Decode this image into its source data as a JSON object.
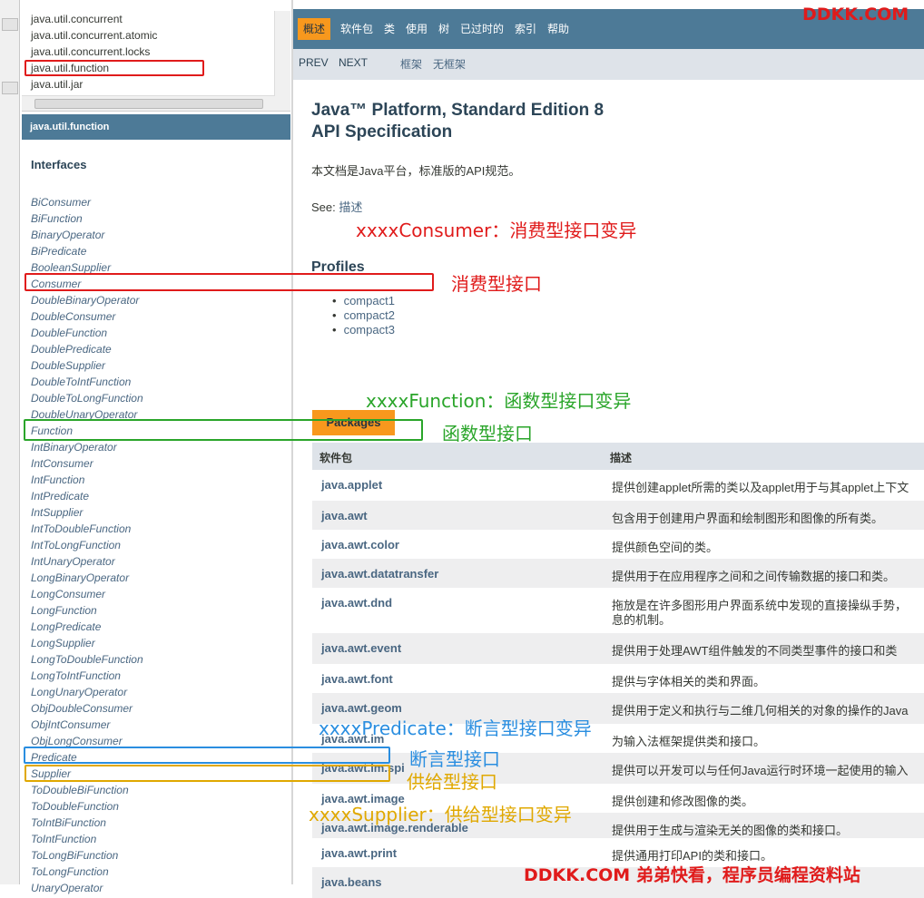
{
  "package_list": [
    "java.util.concurrent",
    "java.util.concurrent.atomic",
    "java.util.concurrent.locks",
    "java.util.function",
    "java.util.jar"
  ],
  "package_header": "java.util.function",
  "interfaces_title": "Interfaces",
  "interfaces": [
    "BiConsumer",
    "BiFunction",
    "BinaryOperator",
    "BiPredicate",
    "BooleanSupplier",
    "Consumer",
    "DoubleBinaryOperator",
    "DoubleConsumer",
    "DoubleFunction",
    "DoublePredicate",
    "DoubleSupplier",
    "DoubleToIntFunction",
    "DoubleToLongFunction",
    "DoubleUnaryOperator",
    "Function",
    "IntBinaryOperator",
    "IntConsumer",
    "IntFunction",
    "IntPredicate",
    "IntSupplier",
    "IntToDoubleFunction",
    "IntToLongFunction",
    "IntUnaryOperator",
    "LongBinaryOperator",
    "LongConsumer",
    "LongFunction",
    "LongPredicate",
    "LongSupplier",
    "LongToDoubleFunction",
    "LongToIntFunction",
    "LongUnaryOperator",
    "ObjDoubleConsumer",
    "ObjIntConsumer",
    "ObjLongConsumer",
    "Predicate",
    "Supplier",
    "ToDoubleBiFunction",
    "ToDoubleFunction",
    "ToIntBiFunction",
    "ToIntFunction",
    "ToLongBiFunction",
    "ToLongFunction",
    "UnaryOperator"
  ],
  "top_nav": [
    "概述",
    "软件包",
    "类",
    "使用",
    "树",
    "已过时的",
    "索引",
    "帮助"
  ],
  "sub_nav": {
    "prev": "PREV",
    "next": "NEXT",
    "frames": "框架",
    "no_frames": "无框架"
  },
  "main": {
    "title_line1": "Java™ Platform, Standard Edition 8",
    "title_line2": "API Specification",
    "description": "本文档是Java平台，标准版的API规范。",
    "see_label": "See: ",
    "see_link": "描述",
    "profiles_title": "Profiles",
    "profiles": [
      "compact1",
      "compact2",
      "compact3"
    ],
    "packages_caption": "Packages",
    "table_header": {
      "package": "软件包",
      "description": "描述"
    },
    "packages": [
      {
        "name": "java.applet",
        "desc": "提供创建applet所需的类以及applet用于与其applet上下文"
      },
      {
        "name": "java.awt",
        "desc": "包含用于创建用户界面和绘制图形和图像的所有类。"
      },
      {
        "name": "java.awt.color",
        "desc": "提供颜色空间的类。"
      },
      {
        "name": "java.awt.datatransfer",
        "desc": "提供用于在应用程序之间和之间传输数据的接口和类。"
      },
      {
        "name": "java.awt.dnd",
        "desc": "拖放是在许多图形用户界面系统中发现的直接操纵手势，",
        "desc2": "息的机制。"
      },
      {
        "name": "java.awt.event",
        "desc": "提供用于处理AWT组件触发的不同类型事件的接口和类"
      },
      {
        "name": "java.awt.font",
        "desc": "提供与字体相关的类和界面。"
      },
      {
        "name": "java.awt.geom",
        "desc": "提供用于定义和执行与二维几何相关的对象的操作的Java"
      },
      {
        "name": "java.awt.im",
        "desc": "为输入法框架提供类和接口。"
      },
      {
        "name": "java.awt.im.spi",
        "desc": "提供可以开发可以与任何Java运行时环境一起使用的输入"
      },
      {
        "name": "java.awt.image",
        "desc": "提供创建和修改图像的类。"
      },
      {
        "name": "java.awt.image.renderable",
        "desc": "提供用于生成与渲染无关的图像的类和接口。"
      },
      {
        "name": "java.awt.print",
        "desc": "提供通用打印API的类和接口。"
      },
      {
        "name": "java.beans",
        "desc": ""
      }
    ]
  },
  "annotations": {
    "consumer_variant": "xxxxConsumer：消费型接口变异",
    "consumer": "消费型接口",
    "function_variant": "xxxxFunction：函数型接口变异",
    "function": "函数型接口",
    "predicate_variant": "xxxxPredicate：断言型接口变异",
    "predicate": "断言型接口",
    "supplier": "供给型接口",
    "supplier_variant": "xxxxSupplier：供给型接口变异"
  },
  "watermarks": {
    "top": "DDKK.COM",
    "bottom": "DDKK.COM 弟弟快看，程序员编程资料站"
  },
  "colors": {
    "nav_blue": "#4d7a97",
    "nav_orange": "#f8981d",
    "link": "#4a6782",
    "red": "#e01b1b",
    "green": "#2aa52a",
    "blue": "#2a8ee0",
    "yellow": "#e0a800"
  }
}
